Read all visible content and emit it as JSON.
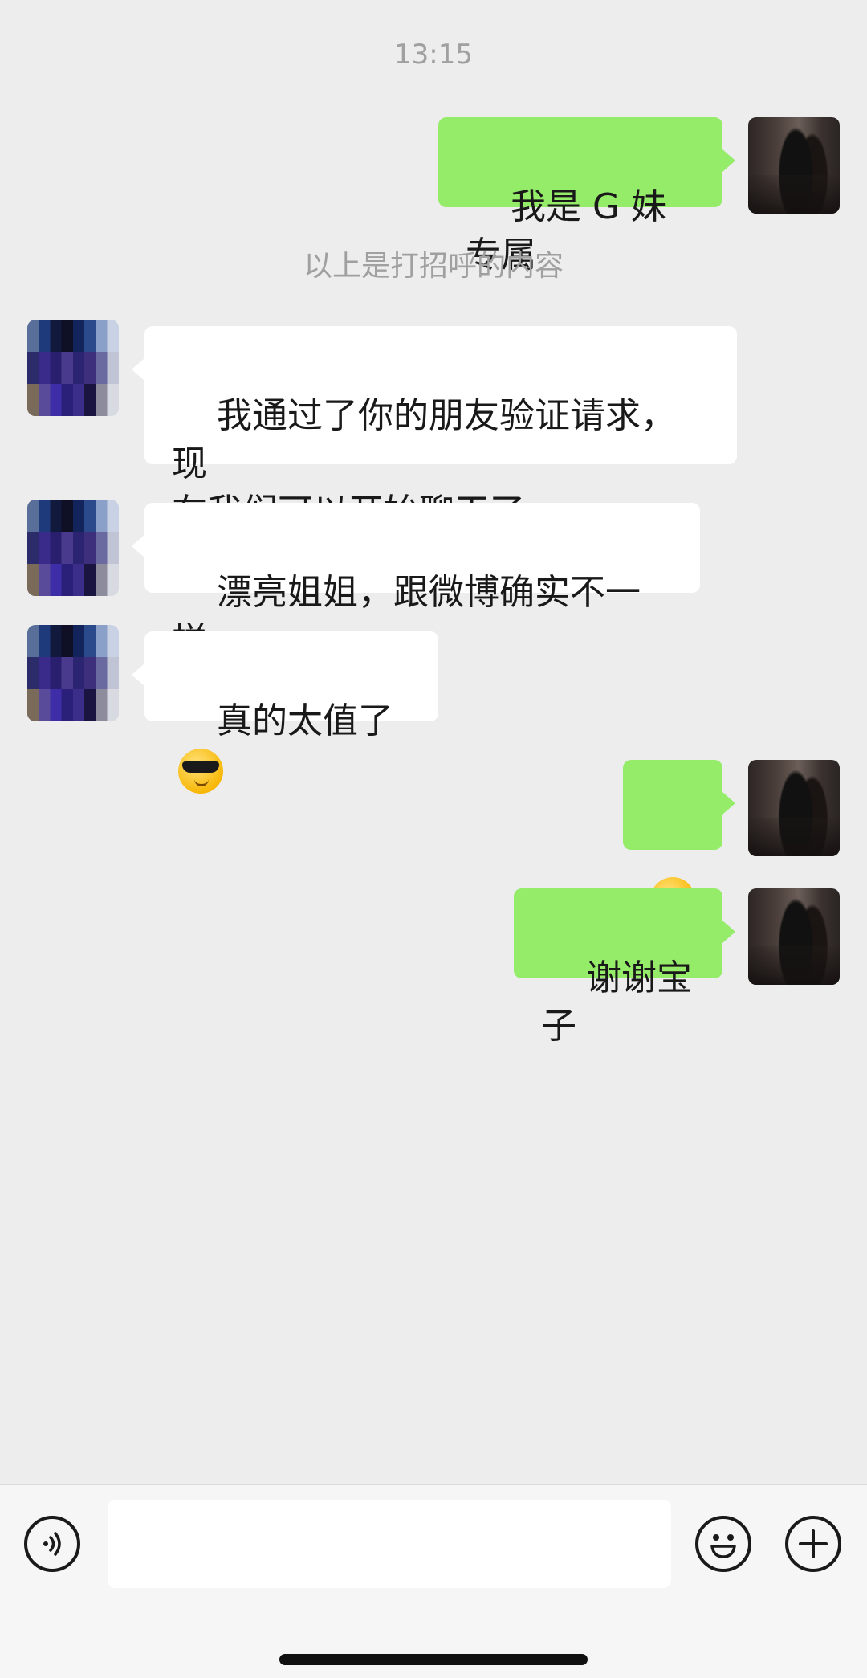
{
  "chat": {
    "timestamp": "13:15",
    "system_message": "以上是打招呼的内容",
    "messages": [
      {
        "sender": "me",
        "text": "我是 G 妹专属"
      },
      {
        "sender": "them",
        "text": "我通过了你的朋友验证请求，现\n在我们可以开始聊天了"
      },
      {
        "sender": "them",
        "text": "漂亮姐姐，跟微博确实不一样"
      },
      {
        "sender": "them",
        "text": "真的太值了",
        "emoji": "smiling-face-with-sunglasses"
      },
      {
        "sender": "me",
        "text": "",
        "emoji": "kissing-face-with-smiling-eyes"
      },
      {
        "sender": "me",
        "text": "谢谢宝子"
      }
    ]
  },
  "input_bar": {
    "text_value": "",
    "voice_icon": "voice-input-icon",
    "emoji_icon": "emoji-icon",
    "add_icon": "plus-icon"
  },
  "colors": {
    "background": "#ededed",
    "my_bubble": "#95ec69",
    "their_bubble": "#ffffff",
    "meta_text": "#a0a0a0"
  }
}
